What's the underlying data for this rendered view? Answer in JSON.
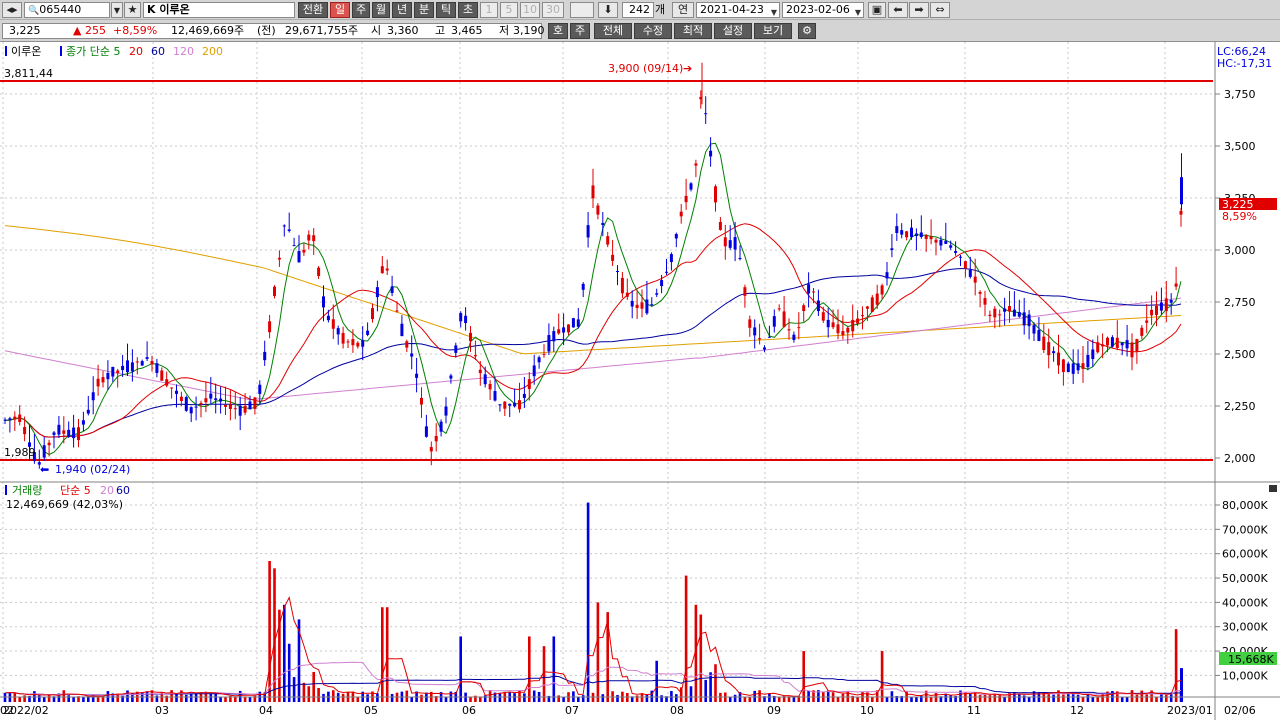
{
  "toolbar": {
    "code": "065440",
    "name": "K 이루온",
    "mode_buttons": [
      "전환",
      "일",
      "주",
      "월",
      "년",
      "분",
      "틱",
      "초",
      "1",
      "5",
      "10",
      "30"
    ],
    "selected_mode": "일",
    "count": "242",
    "count_unit": "개",
    "year_label": "연",
    "date_from": "2021-04-23",
    "date_to": "2023-02-06"
  },
  "quote": {
    "price": "3,225",
    "change_arrow": "▲",
    "change": "255",
    "change_pct": "+8,59%",
    "volume": "12,469,669주",
    "prev_label": "(전)",
    "prev_volume": "29,671,755주",
    "open_label": "시",
    "open": "3,360",
    "high_label": "고",
    "high": "3,465",
    "low_label": "저",
    "low": "3,190"
  },
  "right_buttons": [
    "호",
    "주",
    "전체",
    "수정",
    "최적",
    "설정",
    "보기"
  ],
  "price_legend": {
    "name": "이루온",
    "items": [
      {
        "text": "종가 단순 5",
        "color": "#008000"
      },
      {
        "text": "20",
        "color": "#e00000"
      },
      {
        "text": "60",
        "color": "#0000a0"
      },
      {
        "text": "120",
        "color": "#d080d0"
      },
      {
        "text": "200",
        "color": "#e0a000"
      }
    ],
    "hline_top_label": "3,811,44",
    "hline_bottom_label": "1,989",
    "max_marker": "3,900 (09/14)",
    "min_marker": "1,940 (02/24)",
    "lc": "LC:66,24",
    "hc": "HC:-17,31",
    "current_price_tag": "3,225",
    "current_pct_tag": "8,59%"
  },
  "volume_legend": {
    "title": "거래량",
    "items": [
      {
        "text": "단순 5",
        "color": "#e00000"
      },
      {
        "text": "20",
        "color": "#d080d0"
      },
      {
        "text": "60",
        "color": "#0000a0"
      }
    ],
    "current": "12,469,669 (42,03%)",
    "current_tag": "15,668K"
  },
  "price_axis": [
    "3,750",
    "3,500",
    "3,250",
    "3,000",
    "2,750",
    "2,500",
    "2,250",
    "2,000"
  ],
  "volume_axis": [
    "80,000K",
    "70,000K",
    "60,000K",
    "50,000K",
    "40,000K",
    "30,000K",
    "20,000K",
    "10,000K"
  ],
  "x_axis": [
    "2022/02",
    "03",
    "04",
    "05",
    "06",
    "07",
    "08",
    "09",
    "10",
    "11",
    "12",
    "2023/01",
    "02"
  ],
  "x_axis_right": "02/06",
  "colors": {
    "up": "#e00000",
    "down": "#0000e0",
    "ma5": "#008000",
    "ma20": "#e00000",
    "ma60": "#0000a0",
    "ma120": "#d080d0",
    "ma200": "#e0a000",
    "grid": "#c8c8c8"
  }
}
